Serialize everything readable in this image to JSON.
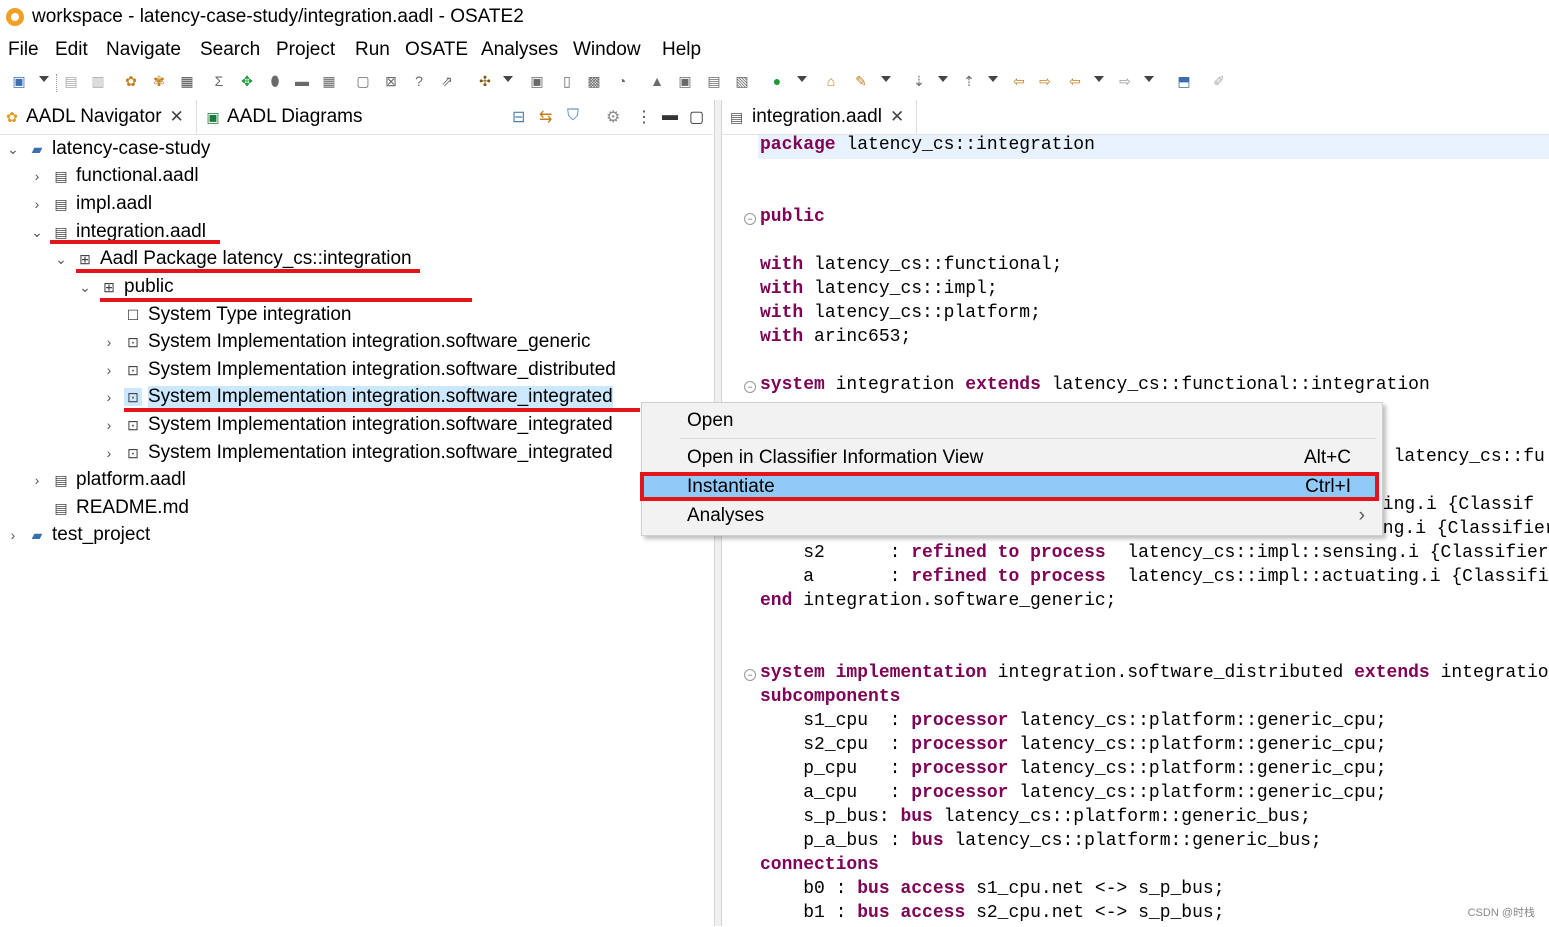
{
  "window": {
    "title": "workspace - latency-case-study/integration.aadl - OSATE2"
  },
  "menubar": [
    "File",
    "Edit",
    "Navigate",
    "Search",
    "Project",
    "Run",
    "OSATE",
    "Analyses",
    "Window",
    "Help"
  ],
  "left_tabs": {
    "navigator": "AADL Navigator",
    "diagrams": "AADL Diagrams"
  },
  "tree": [
    {
      "label": "latency-case-study",
      "icon": "project-folder-icon",
      "level": 0,
      "expanded": true
    },
    {
      "label": "functional.aadl",
      "icon": "aadl-file-icon",
      "level": 1,
      "expanded": false
    },
    {
      "label": "impl.aadl",
      "icon": "aadl-file-icon",
      "level": 1,
      "expanded": false
    },
    {
      "label": "integration.aadl",
      "icon": "aadl-file-icon",
      "level": 1,
      "expanded": true
    },
    {
      "label": "Aadl Package latency_cs::integration",
      "icon": "package-icon",
      "level": 2,
      "expanded": true
    },
    {
      "label": "public",
      "icon": "public-section-icon",
      "level": 3,
      "expanded": true
    },
    {
      "label": "System Type integration",
      "icon": "system-type-icon",
      "level": 4
    },
    {
      "label": "System Implementation integration.software_generic",
      "icon": "system-impl-icon",
      "level": 4
    },
    {
      "label": "System Implementation integration.software_distributed",
      "icon": "system-impl-icon",
      "level": 4
    },
    {
      "label": "System Implementation integration.software_integrated",
      "icon": "system-impl-icon",
      "level": 4,
      "selected": true
    },
    {
      "label": "System Implementation integration.software_integrated",
      "icon": "system-impl-icon",
      "level": 4
    },
    {
      "label": "System Implementation integration.software_integrated",
      "icon": "system-impl-icon",
      "level": 4
    },
    {
      "label": "platform.aadl",
      "icon": "aadl-file-icon",
      "level": 1,
      "expanded": false
    },
    {
      "label": "README.md",
      "icon": "text-file-icon",
      "level": 1
    },
    {
      "label": "test_project",
      "icon": "project-folder-icon",
      "level": 0,
      "expanded": false
    }
  ],
  "editor": {
    "tab": "integration.aadl",
    "lines": {
      "l1": "latency_cs::integration",
      "with1": "latency_cs::functional;",
      "with2": "latency_cs::impl;",
      "with3": "latency_cs::platform;",
      "with4": "arinc653;",
      "sys1_name": "integration",
      "sys1_ext": "latency_cs::functional::integration",
      "partial_a": "s latency_cs::fu",
      "partial_b": "sing.i {Classif",
      "partial_c": "ing.i {Classifier_",
      "s2_name": "s2",
      "s2_rest": "latency_cs::impl::sensing.i {Classifier",
      "a_name": "a",
      "a_rest": "latency_cs::impl::actuating.i {Classifi",
      "end1": "integration.software_generic;",
      "impl2_name": "integration.software_distributed",
      "impl2_ext": "integratio",
      "sc1_name": "s1_cpu",
      "sc1_type": "latency_cs::platform::generic_cpu;",
      "sc2_name": "s2_cpu",
      "sc2_type": "latency_cs::platform::generic_cpu;",
      "sc3_name": "p_cpu",
      "sc3_type": "latency_cs::platform::generic_cpu;",
      "sc4_name": "a_cpu",
      "sc4_type": "latency_cs::platform::generic_cpu;",
      "sc5_name": "s_p_bus:",
      "sc5_type": "latency_cs::platform::generic_bus;",
      "sc6_name": "p_a_bus",
      "sc6_type": "latency_cs::platform::generic_bus;",
      "b0": "s1_cpu.net <-> s_p_bus;",
      "b1": "s2_cpu.net <-> s_p_bus;"
    },
    "keywords": {
      "package": "package",
      "public": "public",
      "with": "with",
      "system": "system",
      "extends": "extends",
      "refined": "refined to process",
      "end": "end",
      "implementation": "system implementation",
      "subcomponents": "subcomponents",
      "processor": "processor",
      "bus": "bus",
      "connections": "connections",
      "busaccess": "bus access",
      "b0": "b0",
      "b1": "b1"
    }
  },
  "context_menu": {
    "open": "Open",
    "classifier_view": "Open in Classifier Information View",
    "classifier_view_key": "Alt+C",
    "instantiate": "Instantiate",
    "instantiate_key": "Ctrl+I",
    "analyses": "Analyses"
  },
  "watermark": "CSDN @时栈",
  "colors": {
    "highlight": "#91c9f7",
    "selection": "#cce8ff",
    "keyword": "#7f0055",
    "annotation_red": "#e4141b"
  }
}
